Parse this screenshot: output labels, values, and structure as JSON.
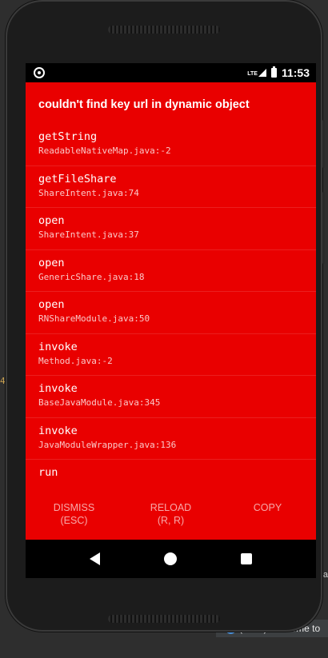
{
  "editor": {
    "gutter_marker": "4",
    "right_fragment": "a",
    "status_message": "(team) Welcome to"
  },
  "statusbar": {
    "network": "LTE",
    "time": "11:53"
  },
  "error": {
    "title": "couldn't find key url in dynamic object"
  },
  "frames": [
    {
      "method": "getString",
      "file": "ReadableNativeMap.java:-2"
    },
    {
      "method": "getFileShare",
      "file": "ShareIntent.java:74"
    },
    {
      "method": "open",
      "file": "ShareIntent.java:37"
    },
    {
      "method": "open",
      "file": "GenericShare.java:18"
    },
    {
      "method": "open",
      "file": "RNShareModule.java:50"
    },
    {
      "method": "invoke",
      "file": "Method.java:-2"
    },
    {
      "method": "invoke",
      "file": "BaseJavaModule.java:345"
    },
    {
      "method": "invoke",
      "file": "JavaModuleWrapper.java:136"
    },
    {
      "method": "run",
      "file": ""
    }
  ],
  "buttons": {
    "dismiss_line1": "DISMISS",
    "dismiss_line2": "(ESC)",
    "reload_line1": "RELOAD",
    "reload_line2": "(R, R)",
    "copy": "COPY"
  },
  "icons": {
    "status_left": "circle-notification-icon",
    "nav_back": "back-triangle-icon",
    "nav_home": "home-circle-icon",
    "nav_recent": "recent-apps-square-icon",
    "info": "info-icon"
  },
  "colors": {
    "error_background": "#e90000",
    "bar_background": "#000000"
  }
}
